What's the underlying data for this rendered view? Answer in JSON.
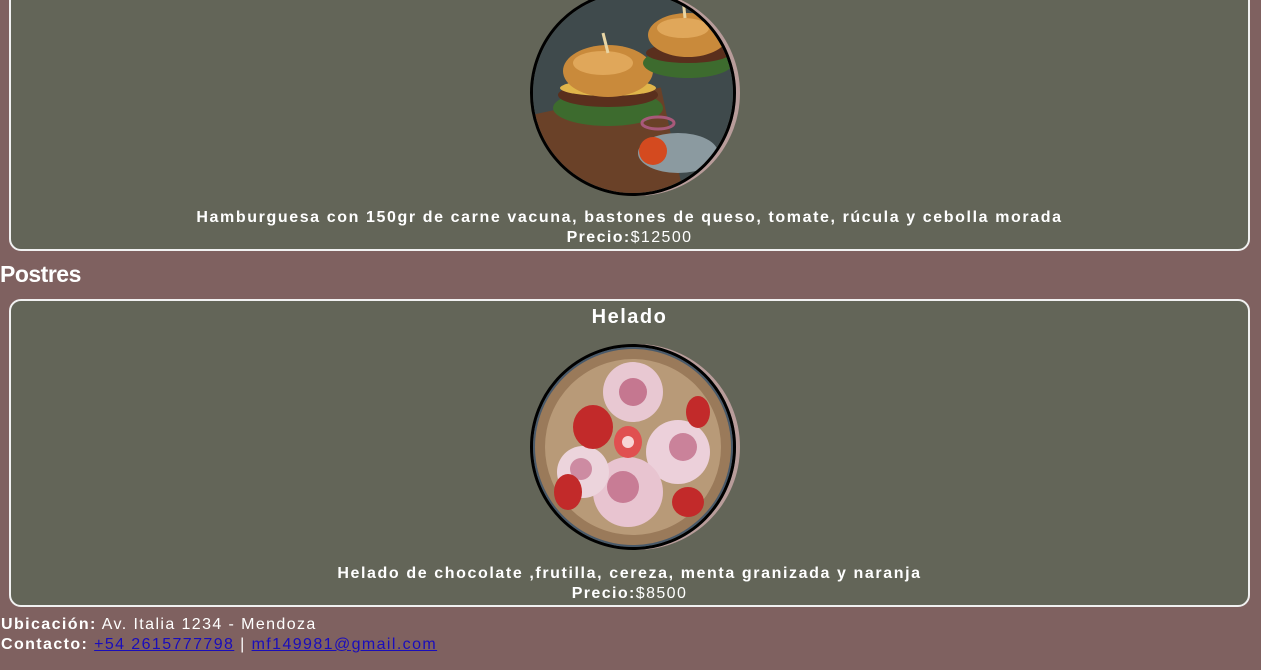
{
  "menu": {
    "burger": {
      "description": "Hamburguesa con 150gr de carne vacuna, bastones de queso, tomate, rúcula y cebolla morada",
      "price_label": "Precio:",
      "price": "$12500"
    },
    "section_postres": "Postres",
    "helado": {
      "title": "Helado",
      "description": "Helado de chocolate ,frutilla, cereza, menta granizada y naranja",
      "price_label": "Precio:",
      "price": "$8500"
    }
  },
  "footer": {
    "location_label": "Ubicación:",
    "location_value": "Av. Italia 1234 - Mendoza",
    "contact_label": "Contacto:",
    "phone": "+54 2615777798",
    "separator": "|",
    "email": "mf149981@gmail.com"
  }
}
